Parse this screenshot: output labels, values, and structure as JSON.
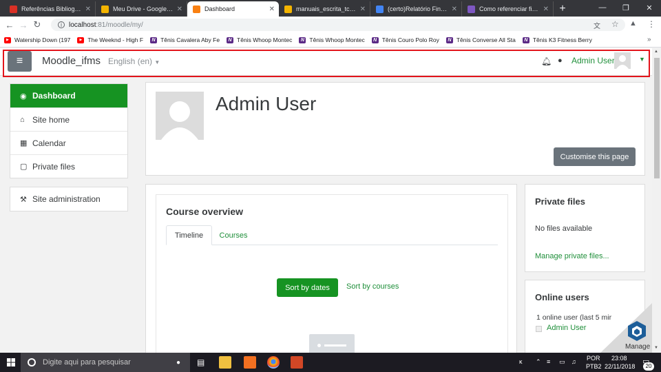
{
  "browser": {
    "tabs": [
      {
        "title": "Referências Bibliográfic",
        "color": "#d93025",
        "active": false
      },
      {
        "title": "Meu Drive - Google Dri",
        "color": "#f4b400",
        "active": false
      },
      {
        "title": "Dashboard",
        "color": "#f98012",
        "active": true
      },
      {
        "title": "manuais_escrita_tcc - A",
        "color": "#f4b400",
        "active": false
      },
      {
        "title": "(certo)Relatório Final - T",
        "color": "#4285f4",
        "active": false
      },
      {
        "title": "Como referenciar figur",
        "color": "#7e57c2",
        "active": false
      }
    ],
    "url_host": "localhost",
    "url_rest": ":81/moodle/my/",
    "bookmarks": [
      {
        "label": "Watership Down (197",
        "icon": "youtube-icon",
        "color": "#ff0000"
      },
      {
        "label": "The Weeknd - High F",
        "icon": "youtube-icon",
        "color": "#ff0000"
      },
      {
        "label": "Tênis Cavalera Aby Fe",
        "icon": "netshoes-icon",
        "color": "#5b2a86"
      },
      {
        "label": "Tênis Whoop Montec",
        "icon": "netshoes-icon",
        "color": "#5b2a86"
      },
      {
        "label": "Tênis Whoop Montec",
        "icon": "netshoes-icon",
        "color": "#5b2a86"
      },
      {
        "label": "Tênis Couro Polo Roy",
        "icon": "netshoes-icon",
        "color": "#5b2a86"
      },
      {
        "label": "Tênis Converse All Sta",
        "icon": "netshoes-icon",
        "color": "#5b2a86"
      },
      {
        "label": "Tênis K3 Fitness Berry",
        "icon": "netshoes-icon",
        "color": "#5b2a86"
      }
    ]
  },
  "navbar": {
    "site_name": "Moodle_ifms",
    "language": "English (en)",
    "user_name": "Admin User"
  },
  "sidebar": {
    "items": [
      {
        "label": "Dashboard",
        "icon": "dashboard-icon",
        "active": true
      },
      {
        "label": "Site home",
        "icon": "home-icon",
        "active": false
      },
      {
        "label": "Calendar",
        "icon": "calendar-icon",
        "active": false
      },
      {
        "label": "Private files",
        "icon": "file-icon",
        "active": false
      }
    ],
    "admin_item": {
      "label": "Site administration",
      "icon": "wrench-icon"
    }
  },
  "header": {
    "user_name": "Admin User",
    "customise_label": "Customise this page"
  },
  "course_overview": {
    "title": "Course overview",
    "tabs": [
      "Timeline",
      "Courses"
    ],
    "sort_dates_label": "Sort by dates",
    "sort_courses_label": "Sort by courses"
  },
  "private_files": {
    "title": "Private files",
    "empty_text": "No files available",
    "manage_link": "Manage private files..."
  },
  "online_users": {
    "title": "Online users",
    "summary": "1 online user (last 5 mir",
    "user": "Admin User"
  },
  "overlay": {
    "manage_label": "Manage"
  },
  "taskbar": {
    "search_placeholder": "Digite aqui para pesquisar",
    "lang_top": "POR",
    "lang_bottom": "PTB2",
    "time": "23:08",
    "date": "22/11/2018",
    "notification_count": "20"
  },
  "colors": {
    "accent": "#169322",
    "link": "#1f8f3a",
    "highlight": "#e3141b"
  }
}
